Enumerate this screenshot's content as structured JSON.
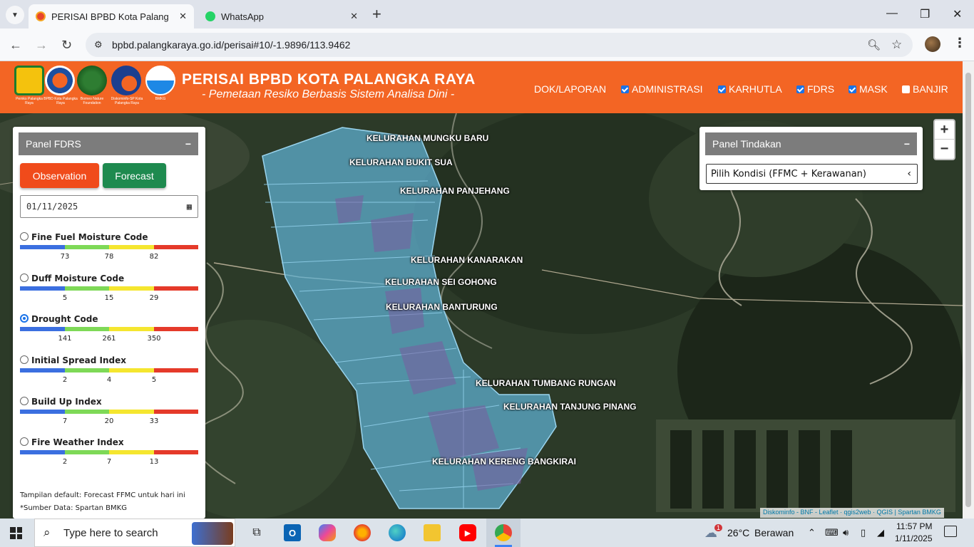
{
  "browser": {
    "tabs": [
      {
        "label": "PERISAI BPBD Kota Palangka Raya",
        "active": true
      },
      {
        "label": "WhatsApp",
        "active": false
      }
    ],
    "url": "bpbd.palangkaraya.go.id/perisai#10/-1.9896/113.9462",
    "new_tab": "+",
    "minimize": "—",
    "restore": "❐",
    "close": "✕"
  },
  "header": {
    "title": "PERISAI BPBD KOTA PALANGKA RAYA",
    "subtitle": "- Pemetaan Resiko Berbasis Sistem Analisa Dini -",
    "logos": [
      {
        "caption": "Pemko Palangka Raya"
      },
      {
        "caption": "BPBD Kota Palangka Raya"
      },
      {
        "caption": "Borneo Nature Foundation"
      },
      {
        "caption": "Diskominfo-SP Kota Palangka Raya"
      },
      {
        "caption": "BMKG"
      }
    ],
    "menu": [
      {
        "label": "DOK/LAPORAN",
        "checkbox": null
      },
      {
        "label": "ADMINISTRASI",
        "checkbox": true
      },
      {
        "label": "KARHUTLA",
        "checkbox": true
      },
      {
        "label": "FDRS",
        "checkbox": true
      },
      {
        "label": "MASK",
        "checkbox": true
      },
      {
        "label": "BANJIR",
        "checkbox": false
      }
    ]
  },
  "panel_fdrs": {
    "title": "Panel FDRS",
    "minimize": "−",
    "observation_label": "Observation",
    "forecast_label": "Forecast",
    "date": "01/11/2025",
    "indices": [
      {
        "name": "Fine Fuel Moisture Code",
        "selected": false,
        "ticks": [
          "73",
          "78",
          "82"
        ]
      },
      {
        "name": "Duff Moisture Code",
        "selected": false,
        "ticks": [
          "5",
          "15",
          "29"
        ]
      },
      {
        "name": "Drought Code",
        "selected": true,
        "ticks": [
          "141",
          "261",
          "350"
        ]
      },
      {
        "name": "Initial Spread Index",
        "selected": false,
        "ticks": [
          "2",
          "4",
          "5"
        ]
      },
      {
        "name": "Build Up Index",
        "selected": false,
        "ticks": [
          "7",
          "20",
          "33"
        ]
      },
      {
        "name": "Fire Weather Index",
        "selected": false,
        "ticks": [
          "2",
          "7",
          "13"
        ]
      }
    ],
    "note_default": "Tampilan default: Forecast FFMC untuk hari ini",
    "note_source": "*Sumber Data: Spartan BMKG",
    "colors": {
      "blue": "#3b6fe0",
      "green": "#7ed957",
      "yellow": "#f5e62f",
      "red": "#e53a2a"
    }
  },
  "panel_tindakan": {
    "title": "Panel Tindakan",
    "minimize": "−",
    "select_value": "Pilih Kondisi (FFMC + Kerawanan)"
  },
  "map": {
    "labels": [
      "KELURAHAN MUNGKU BARU",
      "KELURAHAN BUKIT SUA",
      "KELURAHAN PANJEHANG",
      "KELURAHAN KANARAKAN",
      "KELURAHAN SEI GOHONG",
      "KELURAHAN BANTURUNG",
      "KELURAHAN TUMBANG RUNGAN",
      "KELURAHAN TANJUNG PINANG",
      "KELURAHAN KERENG BANGKIRAI"
    ],
    "zoom_in": "+",
    "zoom_out": "−",
    "attribution": "Diskominfo - BNF - Leaflet · qgis2web · QGIS | Spartan BMKG"
  },
  "taskbar": {
    "search_placeholder": "Type here to search",
    "weather_temp": "26°C",
    "weather_desc": "Berawan",
    "weather_badge": "1",
    "time": "11:57 PM",
    "date": "1/11/2025"
  }
}
